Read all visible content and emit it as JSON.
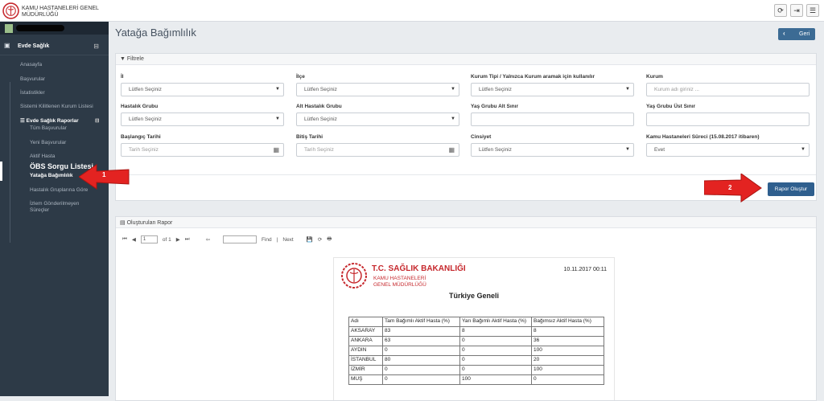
{
  "brand": {
    "line1": "KAMU HASTANELERİ GENEL",
    "line2": "MÜDÜRLÜĞÜ"
  },
  "topbar": {
    "icons": [
      "refresh-icon",
      "logout-icon",
      "menu-icon"
    ],
    "glyphs": [
      "⟳",
      "⇥",
      "☰"
    ]
  },
  "sidebar": {
    "section": "Evde Sağlık",
    "items": [
      "Anasayfa",
      "Başvurular",
      "İstatistikler",
      "Sistemi Kilitlenen Kurum Listesi"
    ],
    "group": "Evde Sağlık Raporlar",
    "group_items": [
      "Tüm Başvurular",
      "Yeni Başvurular",
      "Aktif Hasta"
    ],
    "active_title": "ÖBS Sorgu Listesi",
    "active_item": "Yatağa Bağımlılık",
    "after_items": [
      "Hastalık Gruplarına Göre",
      "İzlem Gönderilmeyen Süreçler"
    ]
  },
  "page": {
    "title": "Yatağa Bağımlılık",
    "back": "Geri"
  },
  "filter": {
    "title": "Filtrele",
    "fields": [
      {
        "label": "İl",
        "value": "Lütfen Seçiniz",
        "kind": "select"
      },
      {
        "label": "İlçe",
        "value": "Lütfen Seçiniz",
        "kind": "select"
      },
      {
        "label": "Kurum Tipi / Yalnızca Kurum aramak için kullanılır",
        "value": "Lütfen Seçiniz",
        "kind": "select"
      },
      {
        "label": "Kurum",
        "value": "Kurum adı giriniz ...",
        "kind": "text"
      },
      {
        "label": "Hastalık Grubu",
        "value": "Lütfen Seçiniz",
        "kind": "select"
      },
      {
        "label": "Alt Hastalık Grubu",
        "value": "Lütfen Seçiniz",
        "kind": "select"
      },
      {
        "label": "Yaş Grubu Alt Sınır",
        "value": "",
        "kind": "text"
      },
      {
        "label": "Yaş Grubu Üst Sınır",
        "value": "",
        "kind": "text"
      },
      {
        "label": "Başlangıç Tarihi",
        "value": "Tarih Seçiniz",
        "kind": "date"
      },
      {
        "label": "Bitiş Tarihi",
        "value": "Tarih Seçiniz",
        "kind": "date"
      },
      {
        "label": "Cinsiyet",
        "value": "Lütfen Seçiniz",
        "kind": "select"
      },
      {
        "label": "Kamu Hastaneleri Süreci (15.08.2017 itibaren)",
        "value": "Evet",
        "kind": "select"
      }
    ],
    "button": "Rapor Oluştur"
  },
  "report": {
    "title": "Oluşturulan Rapor",
    "toolbar": {
      "page": "1",
      "of": "of 1",
      "find": "Find",
      "next": "Next",
      "sep": "|"
    },
    "ministry": "T.C. SAĞLIK BAKANLIĞI",
    "sub1": "KAMU HASTANELERİ",
    "sub2": "GENEL MÜDÜRLÜĞÜ",
    "date": "10.11.2017 00:11",
    "heading": "Türkiye Geneli",
    "columns": [
      "Adı",
      "Tam Bağımlı Aktif Hasta (%)",
      "Yarı Bağımlı Aktif Hasta (%)",
      "Bağımsız Aktif Hasta (%)"
    ],
    "rows": [
      [
        "AKSARAY",
        "83",
        "8",
        "8"
      ],
      [
        "ANKARA",
        "63",
        "0",
        "36"
      ],
      [
        "AYDIN",
        "0",
        "0",
        "100"
      ],
      [
        "İSTANBUL",
        "80",
        "0",
        "20"
      ],
      [
        "İZMİR",
        "0",
        "0",
        "100"
      ],
      [
        "MUŞ",
        "0",
        "100",
        "0"
      ]
    ]
  },
  "callouts": [
    "1",
    "2"
  ],
  "colors": {
    "sidebar": "#2d3a47",
    "primary": "#2f5f8e",
    "arrow": "#e32321"
  }
}
